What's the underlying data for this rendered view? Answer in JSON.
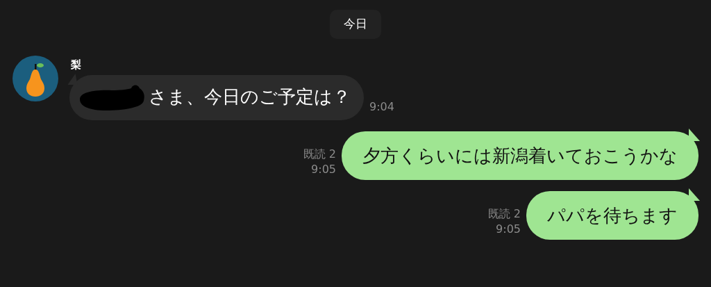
{
  "date_separator": "今日",
  "messages": [
    {
      "kind": "incoming",
      "sender": "梨",
      "redacted": true,
      "text": "さま、今日のご予定は？",
      "time": "9:04"
    },
    {
      "kind": "outgoing",
      "read_receipt": "既読 2",
      "text": "夕方くらいには新潟着いておこうかな",
      "time": "9:05"
    },
    {
      "kind": "outgoing",
      "read_receipt": "既読 2",
      "text": "パパを待ちます",
      "time": "9:05"
    }
  ]
}
